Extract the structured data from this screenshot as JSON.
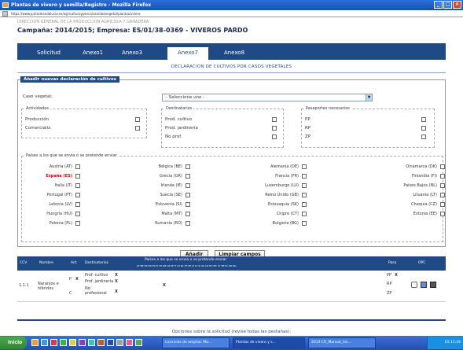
{
  "window": {
    "title": "Plantas de vivero y semilla/Registro - Mozilla Firefox",
    "url": "https://www.juntadeandalucia.es/agriculturaypesca/sanidadvegetal/plantas/vivero"
  },
  "page": {
    "header_small": "DIRECCION GENERAL DE LA PRODUCCION AGRICOLA Y GANADERA",
    "header_main": "Campaña: 2014/2015; Empresa: ES/01/38-0369 - VIVEROS PARDO"
  },
  "tabs": [
    {
      "label": "Solicitud"
    },
    {
      "label": "Anexo1"
    },
    {
      "label": "Anexo3"
    },
    {
      "label": "Anexo7"
    },
    {
      "label": "Anexo8"
    }
  ],
  "section_title": "DECLARACION DE CULTIVOS POR CASOS VEGETALES",
  "form": {
    "title": "Añadir nuevas declaración de cultivos",
    "caso_vegetal_label": "Caso vegetal:",
    "caso_vegetal_value": "- Seleccione uno -",
    "actividad": {
      "title": "Actividades",
      "items": [
        "Producción",
        "Comercializ."
      ]
    },
    "destinatarios": {
      "title": "Destinatarios",
      "items": [
        "Prod. cultivo",
        "Prod. jardinería",
        "No prof."
      ]
    },
    "pasaportes": {
      "title": "Pasaportes necesarios",
      "items": [
        "PP",
        "RP",
        "ZP"
      ]
    },
    "paises": {
      "title": "Países a los que se envía o se pretende enviar",
      "items": [
        "Austria (AT)",
        "Bélgica (BE)",
        "Alemania (DE)",
        "Dinamarca (DK)",
        "España (ES)",
        "Grecia (GR)",
        "Francia (FR)",
        "Finlandia (FI)",
        "Italia (IT)",
        "Irlanda (IE)",
        "Luxemburgo (LU)",
        "Países Bajos (NL)",
        "Portugal (PT)",
        "Suecia (SE)",
        "Reino Unido (GB)",
        "Lituania (LT)",
        "Letonia (LV)",
        "Eslovenia (SI)",
        "Eslovaquia (SK)",
        "Chequia (CZ)",
        "Hungría (HU)",
        "Malta (MT)",
        "Chipre (CY)",
        "Estonia (EE)",
        "Polonia (PL)",
        "Rumanía (RO)",
        "Bulgaria (BG)",
        ""
      ]
    },
    "add_button": "Añadir",
    "clear_button": "Limpiar campos"
  },
  "table": {
    "headers": [
      "CCV",
      "Nombre",
      "Act.",
      "Destinatarios",
      "Países a los que se envía o se pretende enviar",
      "Pasa",
      "OPC"
    ],
    "country_codes": "AT BE DE DK ES FI FR GB GR IE IT LU NL PT SE LT LV SI SK CZ HU MT CY EE PL RO BG",
    "rows": [
      {
        "ccv": "1.1.1",
        "nombre": "Naranjos e híbridos",
        "act_p": "P",
        "act_c": "C",
        "x1": "X",
        "dest1": "Prof. cultivo",
        "dest2": "Prof. jardinería",
        "dest3": "No profesional",
        "dx1": "X",
        "dx2": "X",
        "dx3": "X",
        "es_mark": "X",
        "pasa1": "PP",
        "pasa2": "RP",
        "pasa3": "ZP",
        "px1": "X"
      }
    ]
  },
  "footer_link": "Opciones sobre la solicitud (revise todas las pestañas):",
  "taskbar": {
    "start": "Inicio",
    "items": [
      "Licencias de ampliac Mo...",
      "Plantas de vivero y s...",
      "2014 CR_Manual_Ins..."
    ],
    "tray": "ES 11:24"
  }
}
